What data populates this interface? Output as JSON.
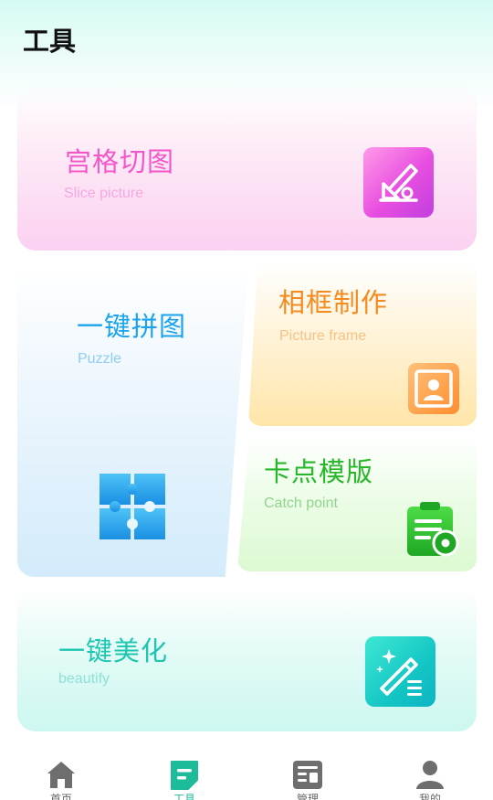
{
  "header": {
    "title": "工具"
  },
  "cards": {
    "slice": {
      "title": "宫格切图",
      "subtitle": "Slice picture",
      "icon": "pencil-ruler-icon"
    },
    "puzzle": {
      "title": "一键拼图",
      "subtitle": "Puzzle",
      "icon": "puzzle-icon"
    },
    "frame": {
      "title": "相框制作",
      "subtitle": "Picture frame",
      "icon": "portrait-frame-icon"
    },
    "catch": {
      "title": "卡点模版",
      "subtitle": "Catch point",
      "icon": "clipboard-gear-icon"
    },
    "beautify": {
      "title": "一键美化",
      "subtitle": "beautify",
      "icon": "magic-wand-icon"
    }
  },
  "tabbar": {
    "items": [
      {
        "label": "首页",
        "icon": "home-icon",
        "active": false
      },
      {
        "label": "工具",
        "icon": "tools-doc-icon",
        "active": true
      },
      {
        "label": "管理",
        "icon": "manage-panel-icon",
        "active": false
      },
      {
        "label": "我的",
        "icon": "user-icon",
        "active": false
      }
    ]
  },
  "colors": {
    "slice": "#f456c9",
    "puzzle": "#1aa3ec",
    "frame": "#f58a1f",
    "catch": "#27b82a",
    "beautify": "#1dc6b1",
    "tab_active": "#1dbb99",
    "tab_inactive": "#666666"
  }
}
